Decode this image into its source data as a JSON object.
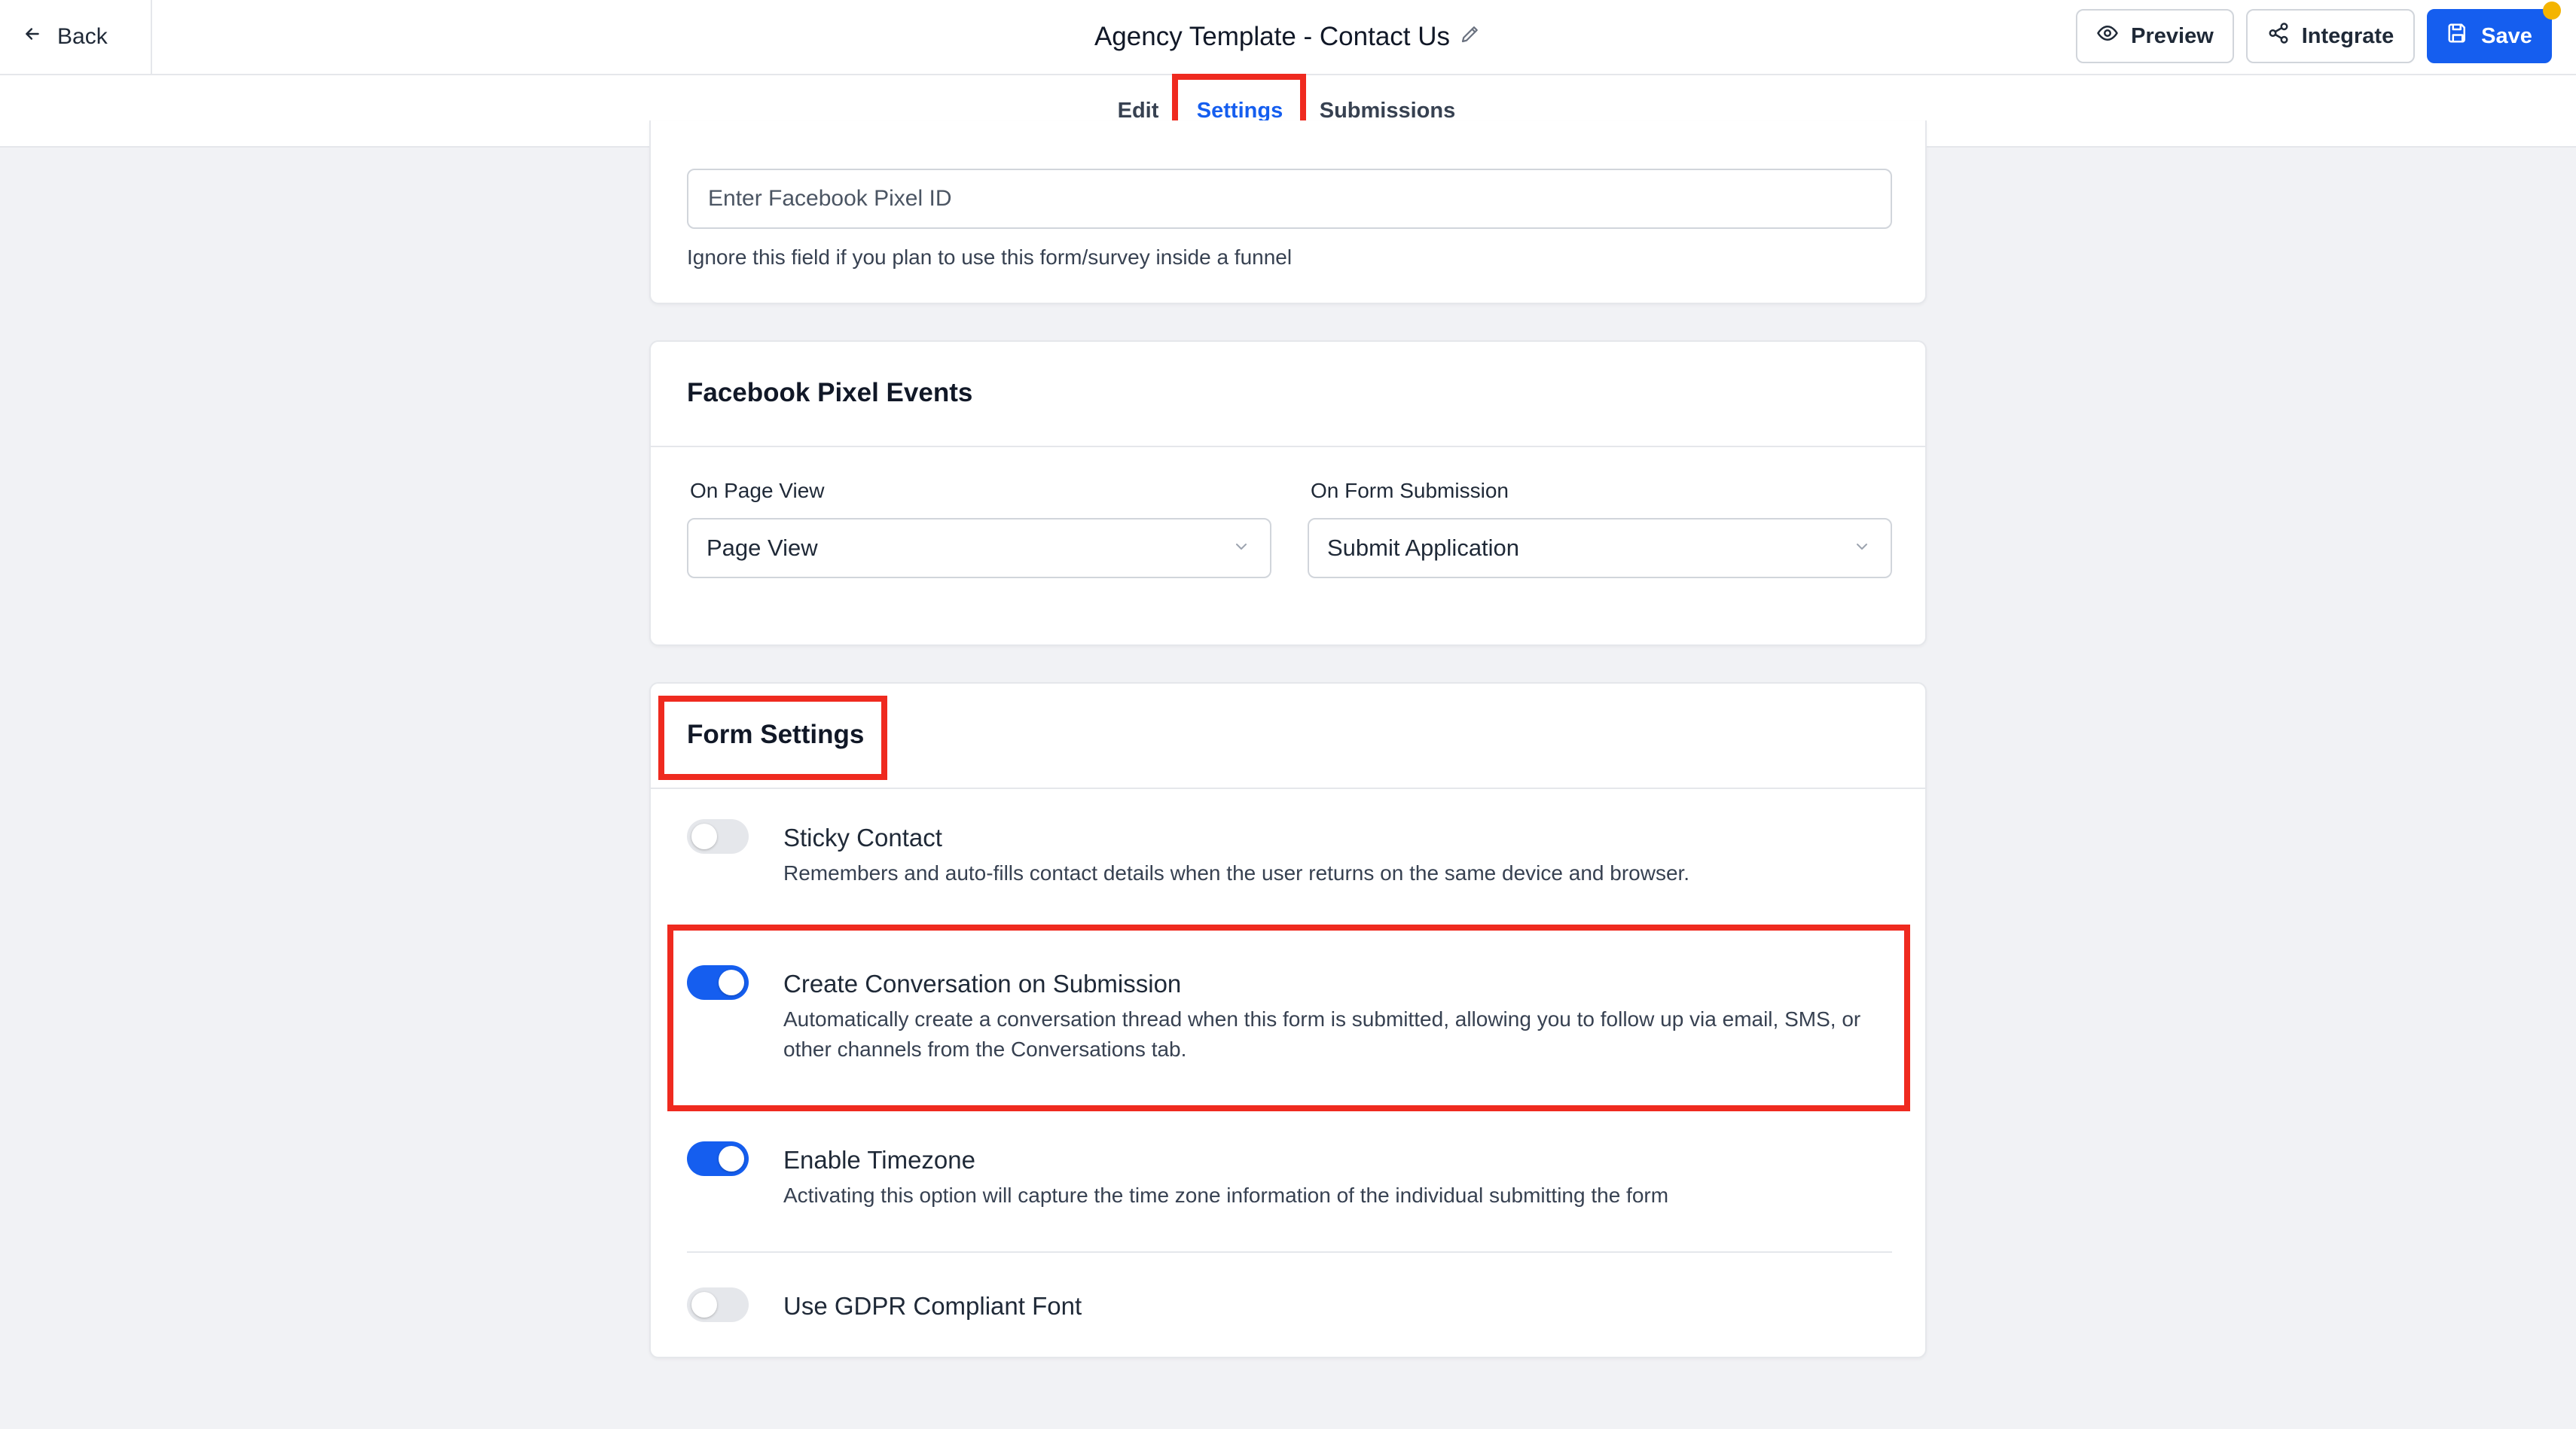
{
  "header": {
    "back_label": "Back",
    "title": "Agency Template - Contact Us",
    "preview_label": "Preview",
    "integrate_label": "Integrate",
    "save_label": "Save"
  },
  "tabs": [
    {
      "label": "Edit",
      "active": false
    },
    {
      "label": "Settings",
      "active": true
    },
    {
      "label": "Submissions",
      "active": false
    }
  ],
  "pixel_id_section": {
    "placeholder": "Enter Facebook Pixel ID",
    "hint": "Ignore this field if you plan to use this form/survey inside a funnel"
  },
  "pixel_events": {
    "title": "Facebook Pixel Events",
    "page_view_label": "On Page View",
    "page_view_value": "Page View",
    "form_submission_label": "On Form Submission",
    "form_submission_value": "Submit Application"
  },
  "form_settings": {
    "title": "Form Settings",
    "options": [
      {
        "title": "Sticky Contact",
        "description": "Remembers and auto-fills contact details when the user returns on the same device and browser.",
        "enabled": false
      },
      {
        "title": "Create Conversation on Submission",
        "description": "Automatically create a conversation thread when this form is submitted, allowing you to follow up via email, SMS, or other channels from the Conversations tab.",
        "enabled": true
      },
      {
        "title": "Enable Timezone",
        "description": "Activating this option will capture the time zone information of the individual submitting the form",
        "enabled": true
      },
      {
        "title": "Use GDPR Compliant Font",
        "description": "",
        "enabled": false
      }
    ]
  },
  "colors": {
    "accent": "#155eef",
    "highlight": "#ef2a1f",
    "notification_dot": "#f4b400"
  },
  "icons": {
    "back": "arrow-left-icon",
    "edit_title": "pencil-icon",
    "preview": "eye-icon",
    "integrate": "share-icon",
    "save": "floppy-disk-icon",
    "select": "chevron-down-icon"
  }
}
